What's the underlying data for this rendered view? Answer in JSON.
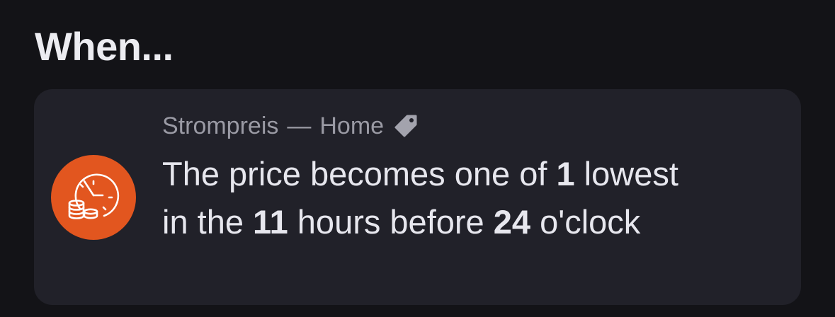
{
  "section": {
    "heading": "When..."
  },
  "trigger_card": {
    "source": {
      "service": "Strompreis",
      "separator": "—",
      "home": "Home"
    },
    "icon": "clock-coins-icon",
    "tag_icon": "tag-icon",
    "description": {
      "part1": "The price becomes one of ",
      "count": "1",
      "part2": " lowest in the ",
      "hours": "11",
      "part3": " hours before ",
      "time": "24",
      "part4": " o'clock"
    },
    "accent_color": "#e2561f"
  }
}
